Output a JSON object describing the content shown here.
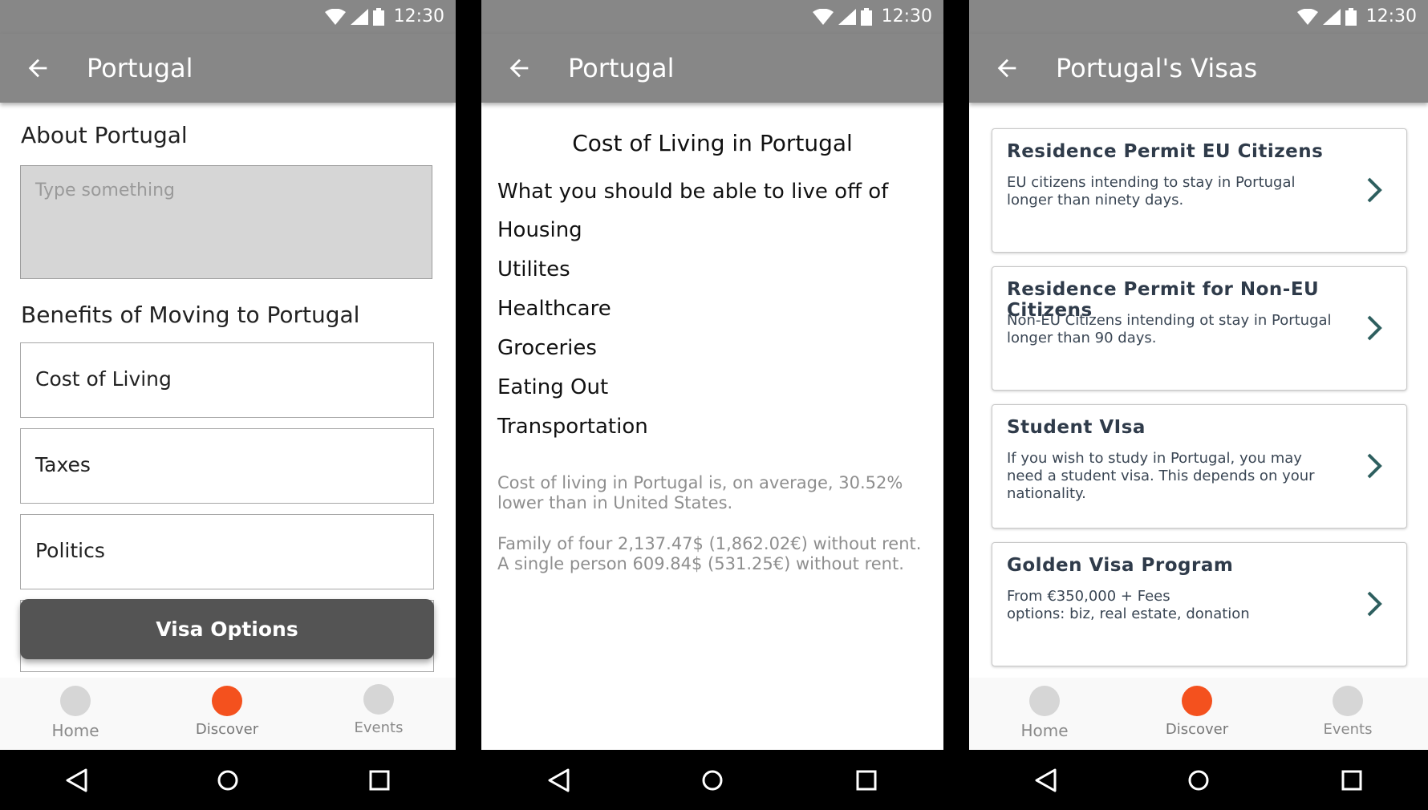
{
  "status_bar": {
    "time": "12:30"
  },
  "screen1": {
    "title": "Portugal",
    "about_heading": "About Portugal",
    "about_placeholder": "Type something",
    "benefits_heading": "Benefits of Moving to Portugal",
    "options": [
      "Cost of Living",
      "Taxes",
      "Politics"
    ],
    "visa_button": "Visa Options"
  },
  "screen2": {
    "title": "Portugal",
    "heading": "Cost of Living in Portugal",
    "subheading": "What you should be able to live off of",
    "items": [
      "Housing",
      "Utilites",
      "Healthcare",
      "Groceries",
      "Eating Out",
      "Transportation"
    ],
    "paragraph1": "Cost of living in Portugal is, on average, 30.52% lower than in United States.",
    "paragraph2_line1": "Family of four 2,137.47$ (1,862.02€) without rent.",
    "paragraph2_line2": "A single person 609.84$ (531.25€) without rent."
  },
  "screen3": {
    "title": "Portugal's Visas",
    "cards": [
      {
        "title": "Residence Permit EU Citizens",
        "desc": "EU citizens intending to stay in Portugal longer than ninety days."
      },
      {
        "title": "Residence Permit for Non-EU Citizens",
        "desc": "Non-EU Citizens intending ot stay in Portugal longer than 90 days."
      },
      {
        "title": "Student VIsa",
        "desc": "If you wish to study in Portugal, you may need a student visa. This depends on your nationality."
      },
      {
        "title": "Golden Visa Program",
        "desc_line1": "From €350,000 + Fees",
        "desc_line2": "options: biz, real estate, donation"
      }
    ]
  },
  "bottom_nav": {
    "home": "Home",
    "discover": "Discover",
    "events": "Events",
    "active": "Discover"
  },
  "colors": {
    "app_bar": "#878787",
    "active_tab": "#f4511e",
    "visa_button": "#545454",
    "chevron": "#2e5f5f"
  },
  "icons": [
    "wifi-icon",
    "signal-icon",
    "battery-icon",
    "back-arrow-icon",
    "chevron-right-icon",
    "nav-back-icon",
    "nav-home-icon",
    "nav-recents-icon"
  ]
}
